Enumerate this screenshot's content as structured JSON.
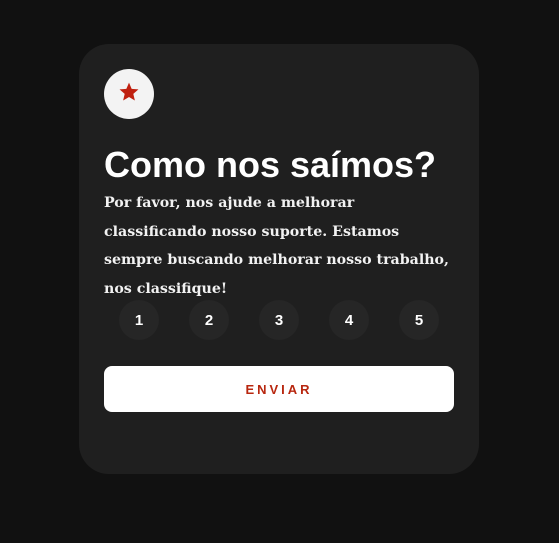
{
  "colors": {
    "page_background": "#111111",
    "card_background": "#1f1f1f",
    "accent": "#c0200f",
    "rating_button_background": "#262626",
    "submit_background": "#ffffff"
  },
  "card": {
    "icon": "star-icon",
    "title": "Como nos saímos?",
    "description": "Por favor, nos ajude a melhorar classificando nosso suporte. Estamos sempre buscando melhorar nosso trabalho, nos classifique!",
    "ratings": [
      "1",
      "2",
      "3",
      "4",
      "5"
    ],
    "submit_label": "ENVIAR"
  }
}
